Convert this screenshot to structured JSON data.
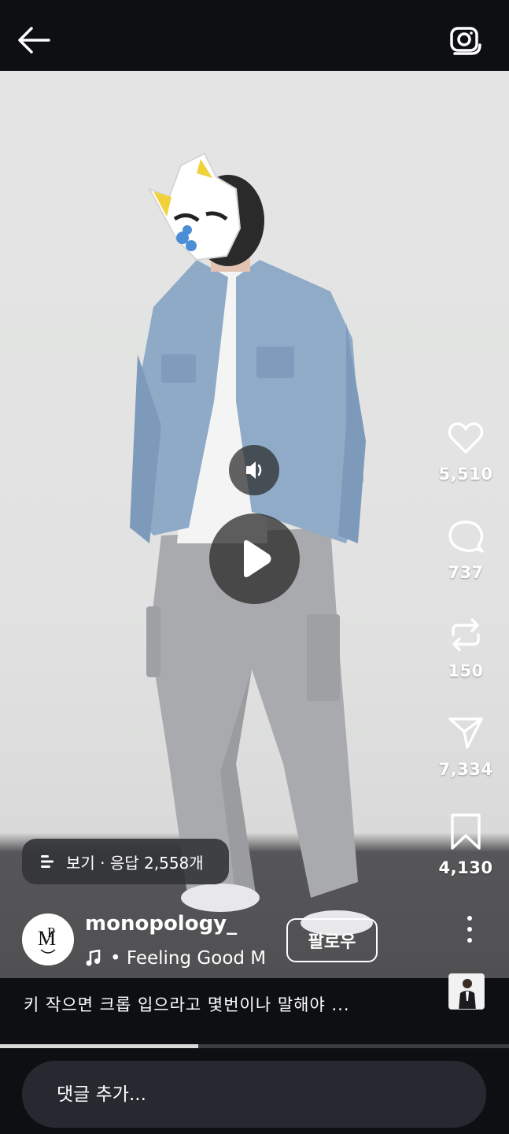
{
  "header": {
    "back_icon": "arrow-left-icon",
    "camera_icon": "camera-icon"
  },
  "video": {
    "mute_icon": "speaker-icon",
    "play_icon": "play-icon",
    "progress": 0.39
  },
  "actions": {
    "like": {
      "icon": "heart-icon",
      "count": "5,510"
    },
    "comment": {
      "icon": "comment-icon",
      "count": "737"
    },
    "repost": {
      "icon": "repost-icon",
      "count": "150"
    },
    "share": {
      "icon": "send-icon",
      "count": "7,334"
    },
    "save": {
      "icon": "bookmark-icon",
      "count": "4,130"
    },
    "more_icon": "more-vertical-icon"
  },
  "responses": {
    "icon": "list-icon",
    "label": "보기 · 응답 2,558개"
  },
  "author": {
    "username": "monopology_",
    "follow_label": "팔로우",
    "audio_icon": "music-note-icon",
    "audio_text": "• Feeling Good   M"
  },
  "caption": {
    "text": "키 작으면 크롭 입으라고 몇번이나 말해야 ..."
  },
  "comment": {
    "placeholder": "댓글 추가..."
  },
  "colors": {
    "background": "#0d0f12",
    "input_background": "#262a30",
    "chip_background": "#323438"
  }
}
